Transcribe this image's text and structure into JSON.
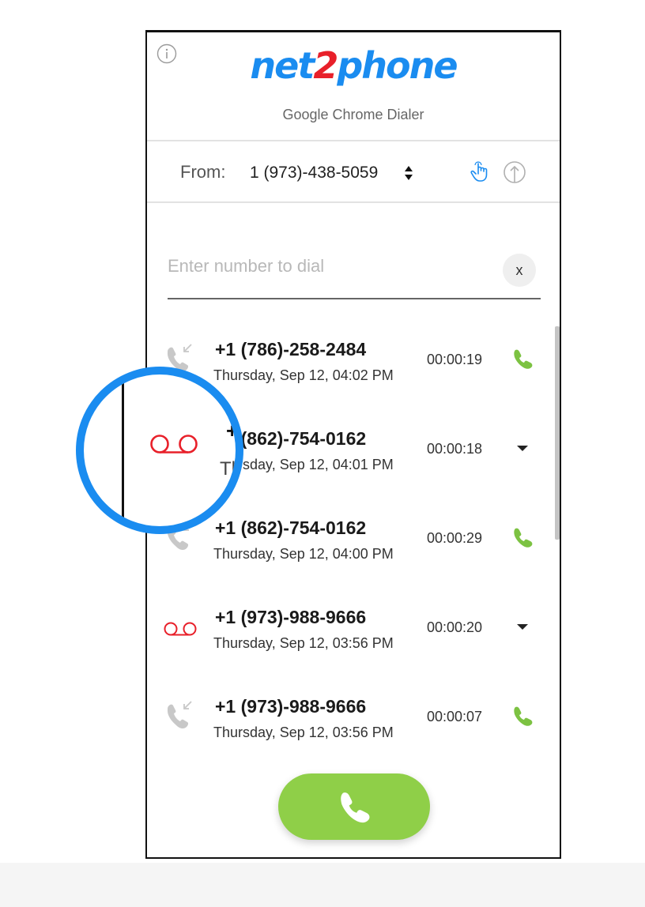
{
  "header": {
    "logo_part1": "net",
    "logo_part2": "2",
    "logo_part3": "phone",
    "subtitle": "Google Chrome Dialer"
  },
  "from": {
    "label": "From:",
    "number": "1 (973)-438-5059"
  },
  "dial": {
    "placeholder": "Enter number to dial",
    "value": "",
    "clear_label": "x"
  },
  "calls": [
    {
      "type": "incoming",
      "number": "+1 (786)-258-2484",
      "date": "Thursday, Sep 12, 04:02 PM",
      "duration": "00:00:19",
      "action": "call"
    },
    {
      "type": "voicemail",
      "number": "+1 (862)-754-0162",
      "date": "Thursday, Sep 12, 04:01 PM",
      "duration": "00:00:18",
      "action": "expand"
    },
    {
      "type": "incoming",
      "number": "+1 (862)-754-0162",
      "date": "Thursday, Sep 12, 04:00 PM",
      "duration": "00:00:29",
      "action": "call"
    },
    {
      "type": "voicemail",
      "number": "+1 (973)-988-9666",
      "date": "Thursday, Sep 12, 03:56 PM",
      "duration": "00:00:20",
      "action": "expand"
    },
    {
      "type": "incoming",
      "number": "+1 (973)-988-9666",
      "date": "Thursday, Sep 12, 03:56 PM",
      "duration": "00:00:07",
      "action": "call"
    }
  ],
  "magnifier": {
    "text_a": "+",
    "text_b": "Th"
  },
  "icons": {
    "info": "info-icon",
    "from_chevron": "sort-chevron-icon",
    "hand": "hand-pointer-icon",
    "upload": "upload-icon",
    "incoming": "incoming-call-icon",
    "voicemail": "voicemail-icon",
    "phone": "phone-icon",
    "expand": "caret-down-icon"
  },
  "colors": {
    "brand_blue": "#1a8cf0",
    "brand_red": "#e8202a",
    "call_green": "#7cc242",
    "call_button": "#8fcf48",
    "voicemail_red": "#e8202a"
  }
}
